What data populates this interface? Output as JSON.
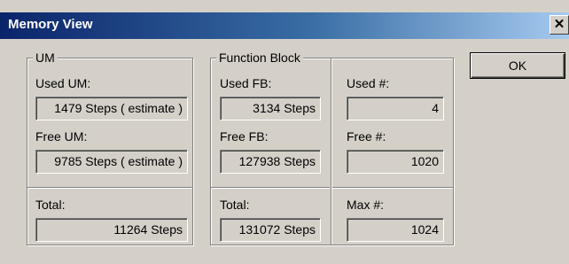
{
  "window": {
    "title": "Memory View",
    "close_glyph": "✕"
  },
  "um": {
    "legend": "UM",
    "used_label": "Used UM:",
    "used_value": "1479 Steps ( estimate )",
    "free_label": "Free UM:",
    "free_value": "9785 Steps ( estimate )",
    "total_label": "Total:",
    "total_value": "11264 Steps"
  },
  "fb": {
    "legend": "Function Block",
    "used_label": "Used FB:",
    "used_value": "3134 Steps",
    "free_label": "Free FB:",
    "free_value": "127938 Steps",
    "total_label": "Total:",
    "total_value": "131072 Steps",
    "used_count_label": "Used #:",
    "used_count_value": "4",
    "free_count_label": "Free #:",
    "free_count_value": "1020",
    "max_count_label": "Max #:",
    "max_count_value": "1024"
  },
  "buttons": {
    "ok_label": "OK"
  }
}
